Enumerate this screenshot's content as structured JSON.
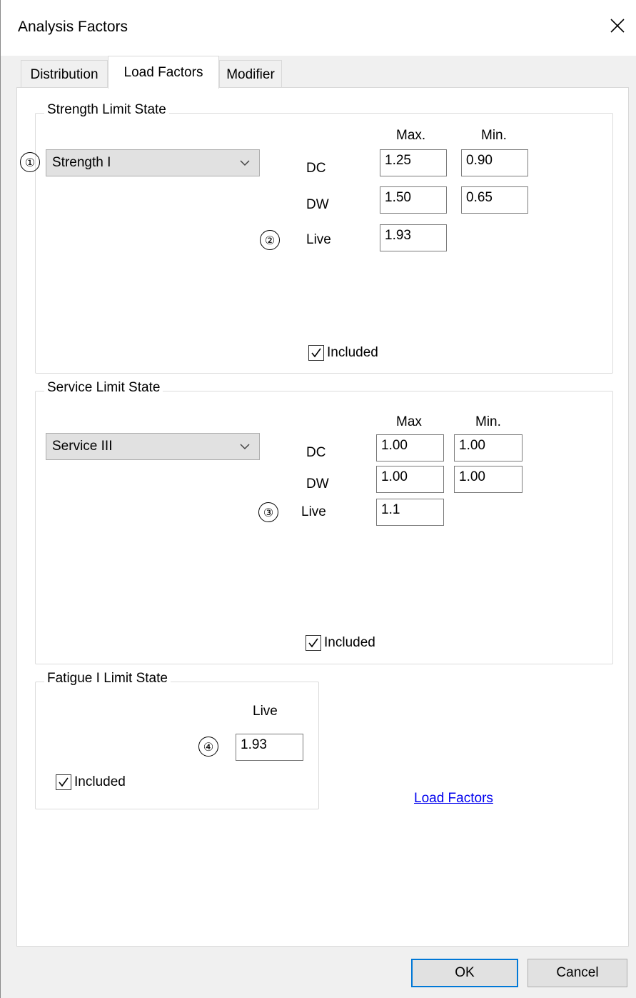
{
  "window": {
    "title": "Analysis Factors",
    "close_icon": "close-icon"
  },
  "tabs": [
    {
      "label": "Distribution",
      "active": false
    },
    {
      "label": "Load Factors",
      "active": true
    },
    {
      "label": "Modifier",
      "active": false
    }
  ],
  "strength": {
    "title": "Strength Limit State",
    "marker": "①",
    "combo_value": "Strength I",
    "col_max": "Max.",
    "col_min": "Min.",
    "rows": [
      {
        "label": "DC",
        "max": "1.25",
        "min": "0.90"
      },
      {
        "label": "DW",
        "max": "1.50",
        "min": "0.65"
      }
    ],
    "live_marker": "②",
    "live_label": "Live",
    "live_value": "1.93",
    "included_label": "Included",
    "included_checked": true
  },
  "service": {
    "title": "Service Limit State",
    "combo_value": "Service III",
    "col_max": "Max",
    "col_min": "Min.",
    "rows": [
      {
        "label": "DC",
        "max": "1.00",
        "min": "1.00"
      },
      {
        "label": "DW",
        "max": "1.00",
        "min": "1.00"
      }
    ],
    "live_marker": "③",
    "live_label": "Live",
    "live_value": "1.1",
    "included_label": "Included",
    "included_checked": true
  },
  "fatigue": {
    "title": "Fatigue I Limit State",
    "live_col": "Live",
    "live_marker": "④",
    "live_value": "1.93",
    "included_label": "Included",
    "included_checked": true
  },
  "link_label": "Load Factors",
  "buttons": {
    "ok": "OK",
    "cancel": "Cancel"
  },
  "colors": {
    "accent": "#0078d7",
    "link": "#0000ee"
  }
}
